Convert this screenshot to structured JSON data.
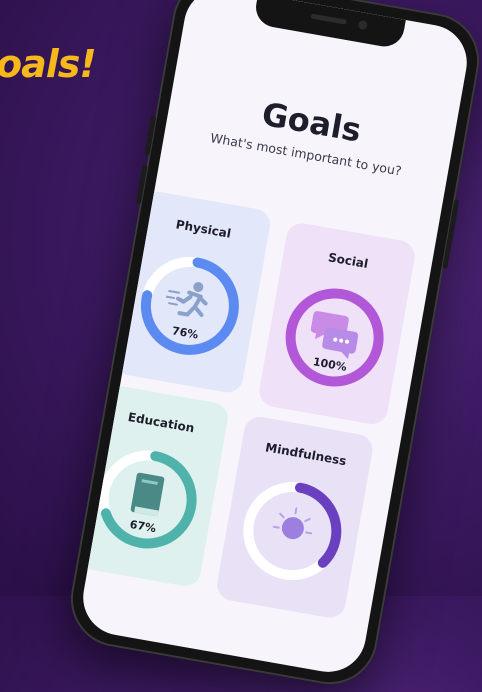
{
  "headline": "oals!",
  "screen": {
    "title": "Goals",
    "subtitle": "What's most important to you?"
  },
  "cards": [
    {
      "label": "Physical",
      "percent_label": "76%",
      "progress": 0.76,
      "icon": "running-person-icon",
      "ring_color": "#5b8bf0",
      "bg": "#e3e7fa"
    },
    {
      "label": "Social",
      "percent_label": "100%",
      "progress": 1.0,
      "icon": "chat-bubbles-icon",
      "ring_color": "#b257d8",
      "bg": "#efe1f8"
    },
    {
      "label": "Education",
      "percent_label": "67%",
      "progress": 0.67,
      "icon": "book-icon",
      "ring_color": "#4fb3ac",
      "bg": "#def1ee"
    },
    {
      "label": "Mindfulness",
      "percent_label": "",
      "progress": 0.35,
      "icon": "lightbulb-icon",
      "ring_color": "#6a3fc0",
      "bg": "#e9e1f6"
    }
  ],
  "colors": {
    "headline": "#f6b81a",
    "background": "#3d1a63"
  }
}
